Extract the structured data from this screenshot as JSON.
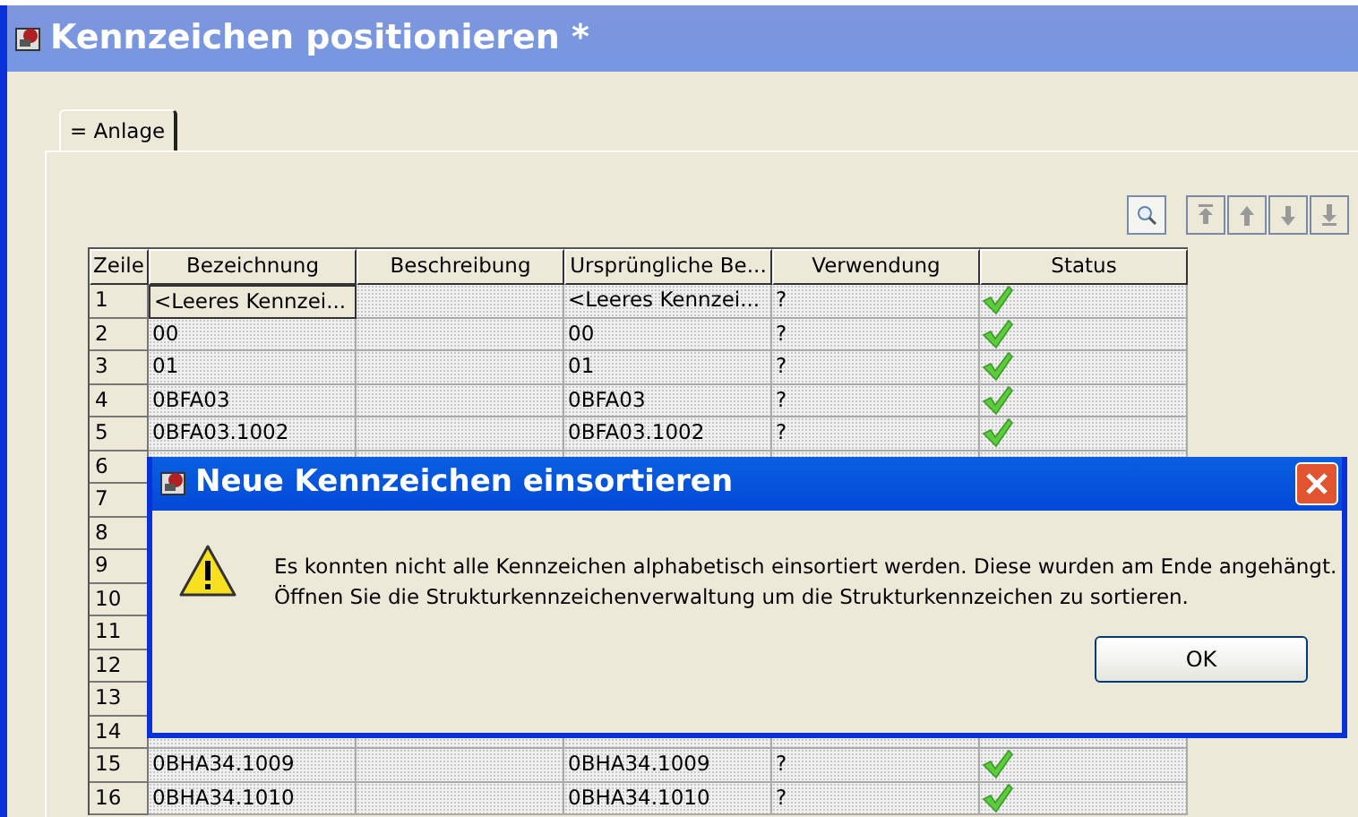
{
  "window": {
    "title": "Kennzeichen positionieren *"
  },
  "tabs": [
    {
      "label": "= Anlage",
      "selected": true
    }
  ],
  "table": {
    "columns": [
      "Zeile",
      "Bezeichnung",
      "Beschreibung",
      "Ursprüngliche Be...",
      "Verwendung",
      "Status"
    ],
    "rows": [
      {
        "zeile": "1",
        "bezeichnung": "<Leeres Kennzei...",
        "urspruenglich": "<Leeres Kennzei...",
        "verwendung": "?",
        "valid": true,
        "selected": true
      },
      {
        "zeile": "2",
        "bezeichnung": "00",
        "urspruenglich": "00",
        "verwendung": "?",
        "valid": true,
        "selected": false
      },
      {
        "zeile": "3",
        "bezeichnung": "01",
        "urspruenglich": "01",
        "verwendung": "?",
        "valid": true,
        "selected": false
      },
      {
        "zeile": "4",
        "bezeichnung": "0BFA03",
        "urspruenglich": "0BFA03",
        "verwendung": "?",
        "valid": true,
        "selected": false
      },
      {
        "zeile": "5",
        "bezeichnung": "0BFA03.1002",
        "urspruenglich": "0BFA03.1002",
        "verwendung": "?",
        "valid": true,
        "selected": false
      },
      {
        "zeile": "6",
        "selected": false
      },
      {
        "zeile": "7",
        "selected": false
      },
      {
        "zeile": "8",
        "selected": false
      },
      {
        "zeile": "9",
        "selected": false
      },
      {
        "zeile": "10",
        "selected": false
      },
      {
        "zeile": "11",
        "selected": false
      },
      {
        "zeile": "12",
        "selected": false
      },
      {
        "zeile": "13",
        "selected": false
      },
      {
        "zeile": "14",
        "selected": false
      },
      {
        "zeile": "15",
        "bezeichnung": "0BHA34.1009",
        "urspruenglich": "0BHA34.1009",
        "verwendung": "?",
        "valid": true,
        "selected": false
      },
      {
        "zeile": "16",
        "bezeichnung": "0BHA34.1010",
        "urspruenglich": "0BHA34.1010",
        "verwendung": "?",
        "valid": true,
        "selected": false
      }
    ]
  },
  "dialog": {
    "title": "Neue Kennzeichen einsortieren",
    "message": [
      "Es konnten nicht alle Kennzeichen alphabetisch einsortiert werden. Diese wurden am Ende angehängt.",
      "Öffnen Sie die Strukturkennzeichenverwaltung um die Strukturkennzeichen zu sortieren."
    ],
    "button": "OK"
  }
}
